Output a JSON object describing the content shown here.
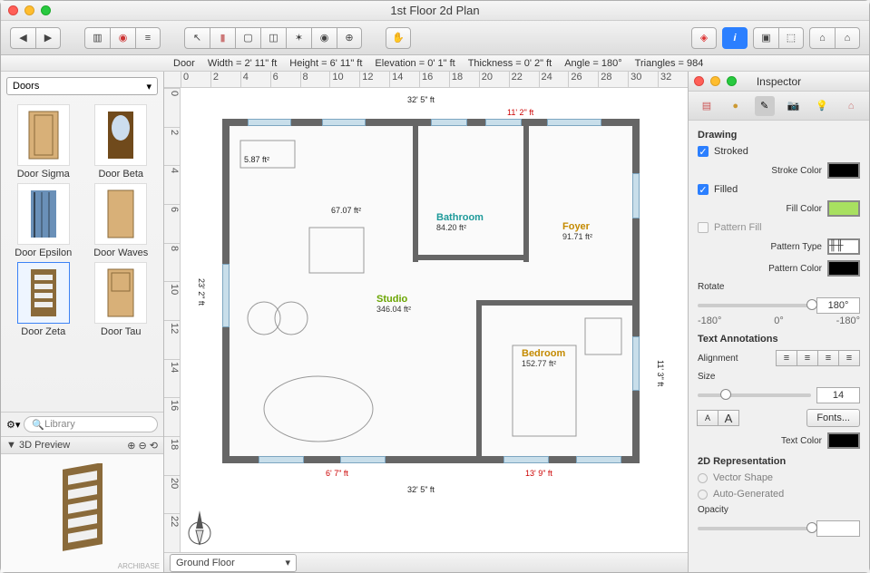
{
  "window": {
    "title": "1st Floor 2d Plan"
  },
  "status": {
    "object": "Door",
    "width_lbl": "Width =",
    "width_val": "2' 11\" ft",
    "height_lbl": "Height =",
    "height_val": "6' 11\" ft",
    "elev_lbl": "Elevation =",
    "elev_val": "0' 1\" ft",
    "thick_lbl": "Thickness =",
    "thick_val": "0' 2\" ft",
    "angle_lbl": "Angle =",
    "angle_val": "180°",
    "tri_lbl": "Triangles =",
    "tri_val": "984"
  },
  "library": {
    "category": "Doors",
    "search_placeholder": "Library",
    "items": [
      {
        "label": "Door Sigma"
      },
      {
        "label": "Door Beta"
      },
      {
        "label": "Door Epsilon"
      },
      {
        "label": "Door Waves"
      },
      {
        "label": "Door Zeta"
      },
      {
        "label": "Door Tau"
      }
    ],
    "preview_title": "3D Preview"
  },
  "floorplan": {
    "floor_selector": "Ground Floor",
    "outer_w": "32' 5\" ft",
    "outer_h": "23' 2\" ft",
    "dim_top_red": "11' 2\" ft",
    "dim_bot_left": "6' 7\" ft",
    "dim_bot_right": "13' 9\" ft",
    "dim_right": "11' 3\" ft",
    "area_note1": "5.87 ft²",
    "area_note2": "67.07 ft²",
    "rooms": {
      "bathroom": {
        "name": "Bathroom",
        "area": "84.20 ft²",
        "color": "#1e9a9a"
      },
      "foyer": {
        "name": "Foyer",
        "area": "91.71 ft²",
        "color": "#c48a00"
      },
      "studio": {
        "name": "Studio",
        "area": "346.04 ft²",
        "color": "#6aa500"
      },
      "bedroom": {
        "name": "Bedroom",
        "area": "152.77 ft²",
        "color": "#c48a00"
      }
    }
  },
  "inspector": {
    "title": "Inspector",
    "drawing_h": "Drawing",
    "stroked_lbl": "Stroked",
    "stroke_color_lbl": "Stroke Color",
    "filled_lbl": "Filled",
    "fill_color_lbl": "Fill Color",
    "pattern_fill_lbl": "Pattern Fill",
    "pattern_type_lbl": "Pattern Type",
    "pattern_color_lbl": "Pattern Color",
    "rotate_lbl": "Rotate",
    "rotate_val": "180°",
    "scale_min": "-180°",
    "scale_mid": "0°",
    "scale_max": "-180°",
    "text_h": "Text Annotations",
    "align_lbl": "Alignment",
    "size_lbl": "Size",
    "size_val": "14",
    "fonts_btn": "Fonts...",
    "textcolor_lbl": "Text Color",
    "rep_h": "2D Representation",
    "vector_lbl": "Vector Shape",
    "auto_lbl": "Auto-Generated",
    "opacity_lbl": "Opacity",
    "colors": {
      "stroke": "#000000",
      "fill": "#a8e060",
      "pattern": "#000000",
      "text": "#000000"
    }
  },
  "ruler_h": [
    "0",
    "2",
    "4",
    "6",
    "8",
    "10",
    "12",
    "14",
    "16",
    "18",
    "20",
    "22",
    "24",
    "26",
    "28",
    "30",
    "32"
  ],
  "ruler_v": [
    "0",
    "2",
    "4",
    "6",
    "8",
    "10",
    "12",
    "14",
    "16",
    "18",
    "20",
    "22"
  ]
}
